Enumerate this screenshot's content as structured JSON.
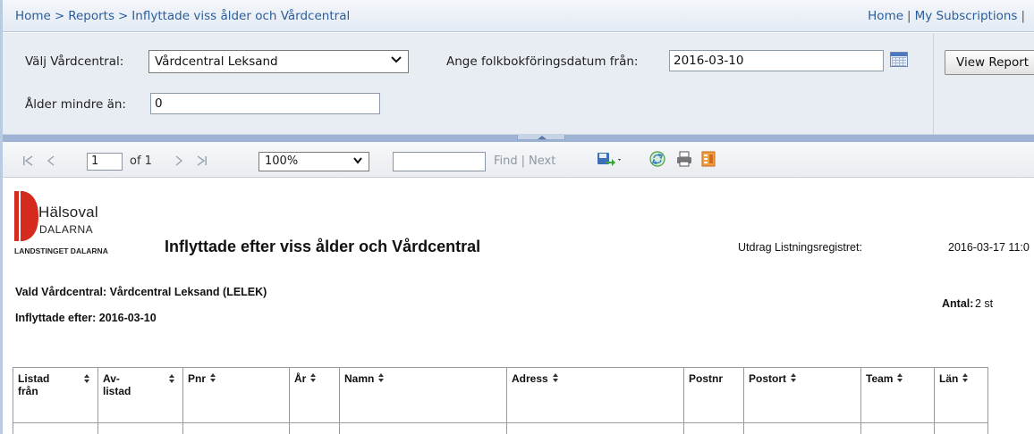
{
  "breadcrumb": {
    "home": "Home",
    "separator": ">",
    "reports": "Reports",
    "current": "Inflyttade viss ålder och Vårdcentral"
  },
  "top_links": {
    "home": "Home",
    "separator": "|",
    "subscriptions": "My Subscriptions",
    "tail": "|"
  },
  "parameters": {
    "vardcentral_label": "Välj Vårdcentral:",
    "vardcentral_value": "Vårdcentral Leksand",
    "datum_label": "Ange folkbokföringsdatum från:",
    "datum_value": "2016-03-10",
    "alder_label": "Ålder mindre än:",
    "alder_value": "0",
    "view_button": "View Report"
  },
  "toolbar": {
    "page_value": "1",
    "page_of": "of 1",
    "zoom_value": "100%",
    "find_value": "",
    "find_label": "Find",
    "find_separator": "|",
    "next_label": "Next"
  },
  "report": {
    "logo": {
      "line1": "Hälsoval",
      "line2": "DALARNA",
      "line3": "LANDSTINGET DALARNA",
      "brand_color": "#d52b1e"
    },
    "title": "Inflyttade efter viss ålder och Vårdcentral",
    "utdrag_label": "Utdrag Listningsregistret:",
    "utdrag_value": "2016-03-17 11:0",
    "vald_vardcentral": "Vald Vårdcentral: Vårdcentral Leksand (LELEK)",
    "inflyttade_efter": "Inflyttade efter: 2016-03-10",
    "antal_label": "Antal:",
    "antal_value": "2 st",
    "columns": [
      {
        "label": "Listad från",
        "sortable": true
      },
      {
        "label": "Av-listad",
        "sortable": true
      },
      {
        "label": "Pnr",
        "sortable": true
      },
      {
        "label": "År",
        "sortable": true
      },
      {
        "label": "Namn",
        "sortable": true
      },
      {
        "label": "Adress",
        "sortable": true
      },
      {
        "label": "Postnr",
        "sortable": false
      },
      {
        "label": "Postort",
        "sortable": true
      },
      {
        "label": "Team",
        "sortable": true
      },
      {
        "label": "Län",
        "sortable": true
      }
    ]
  },
  "colors": {
    "link": "#2b5d9a",
    "param_bg": "#e8ecf3",
    "splitter": "#9fb4d4"
  }
}
